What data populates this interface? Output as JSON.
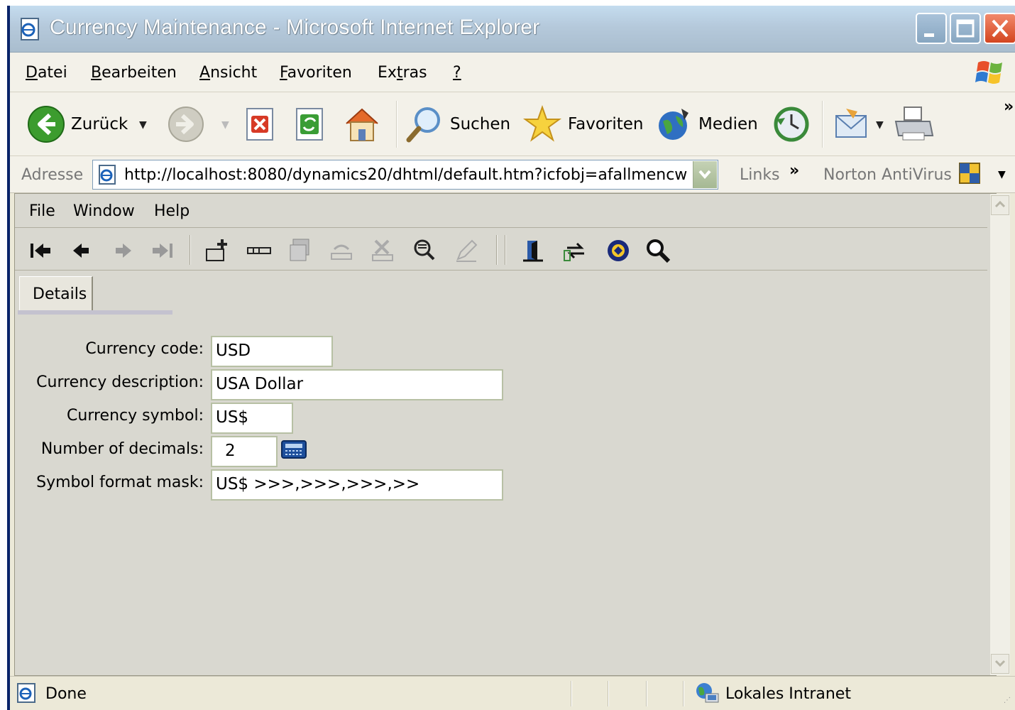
{
  "window": {
    "title": "Currency Maintenance - Microsoft Internet Explorer"
  },
  "menubar": {
    "items": [
      {
        "label": "Datei",
        "accel": "D"
      },
      {
        "label": "Bearbeiten",
        "accel": "B"
      },
      {
        "label": "Ansicht",
        "accel": "A"
      },
      {
        "label": "Favoriten",
        "accel": "F"
      },
      {
        "label": "Extras",
        "accel": "t"
      },
      {
        "label": "?",
        "accel": "?"
      }
    ]
  },
  "toolbar": {
    "back_label": "Zurück",
    "search_label": "Suchen",
    "favorites_label": "Favoriten",
    "media_label": "Medien",
    "overflow": "»"
  },
  "addressbar": {
    "label": "Adresse",
    "url": "http://localhost:8080/dynamics20/dhtml/default.htm?icfobj=afallmencw",
    "links_label": "Links",
    "links_chevron": "»",
    "norton_label": "Norton AntiVirus"
  },
  "app": {
    "menu": [
      "File",
      "Window",
      "Help"
    ],
    "tab_label": "Details",
    "fields": {
      "currency_code": {
        "label": "Currency code:",
        "value": "USD"
      },
      "currency_description": {
        "label": "Currency description:",
        "value": "USA Dollar"
      },
      "currency_symbol": {
        "label": "Currency symbol:",
        "value": "US$"
      },
      "number_of_decimals": {
        "label": "Number of decimals:",
        "value": "2"
      },
      "symbol_format_mask": {
        "label": "Symbol format mask:",
        "value": "US$ >>>,>>>,>>>,>>"
      }
    }
  },
  "statusbar": {
    "status": "Done",
    "zone": "Lokales Intranet"
  },
  "colors": {
    "titlebar": "#b5c9db",
    "chrome": "#ece9d8",
    "content_bg": "#d9d8d0",
    "input_border": "#b7c0a4",
    "close_button": "#d3451f"
  }
}
